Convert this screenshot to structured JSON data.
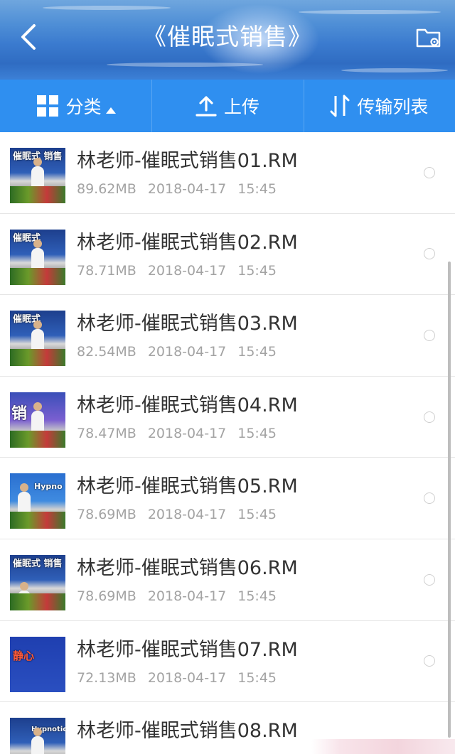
{
  "header": {
    "title": "《催眠式销售》",
    "back_icon": "chevron-left-icon",
    "folder_settings_icon": "folder-settings-icon"
  },
  "toolbar": {
    "category_label": "分类",
    "upload_label": "上传",
    "transfer_label": "传输列表"
  },
  "colors": {
    "toolbar_bg": "#2f8ff0",
    "text_primary": "#333333",
    "text_secondary": "#a3a3a3"
  },
  "files": [
    {
      "name": "林老师-催眠式销售01.RM",
      "size": "89.62MB",
      "date": "2018-04-17",
      "time": "15:45",
      "thumb_text": "催眠式 销售"
    },
    {
      "name": "林老师-催眠式销售02.RM",
      "size": "78.71MB",
      "date": "2018-04-17",
      "time": "15:45",
      "thumb_text": "催眠式"
    },
    {
      "name": "林老师-催眠式销售03.RM",
      "size": "82.54MB",
      "date": "2018-04-17",
      "time": "15:45",
      "thumb_text": "催眠式"
    },
    {
      "name": "林老师-催眠式销售04.RM",
      "size": "78.47MB",
      "date": "2018-04-17",
      "time": "15:45",
      "thumb_text": "销"
    },
    {
      "name": "林老师-催眠式销售05.RM",
      "size": "78.69MB",
      "date": "2018-04-17",
      "time": "15:45",
      "thumb_text": "Hypno"
    },
    {
      "name": "林老师-催眠式销售06.RM",
      "size": "78.69MB",
      "date": "2018-04-17",
      "time": "15:45",
      "thumb_text": "催眠式 销售"
    },
    {
      "name": "林老师-催眠式销售07.RM",
      "size": "72.13MB",
      "date": "2018-04-17",
      "time": "15:45",
      "thumb_text": "静心"
    },
    {
      "name": "林老师-催眠式销售08.RM",
      "size": "",
      "date": "",
      "time": "",
      "thumb_text": "Hypnotic"
    }
  ]
}
